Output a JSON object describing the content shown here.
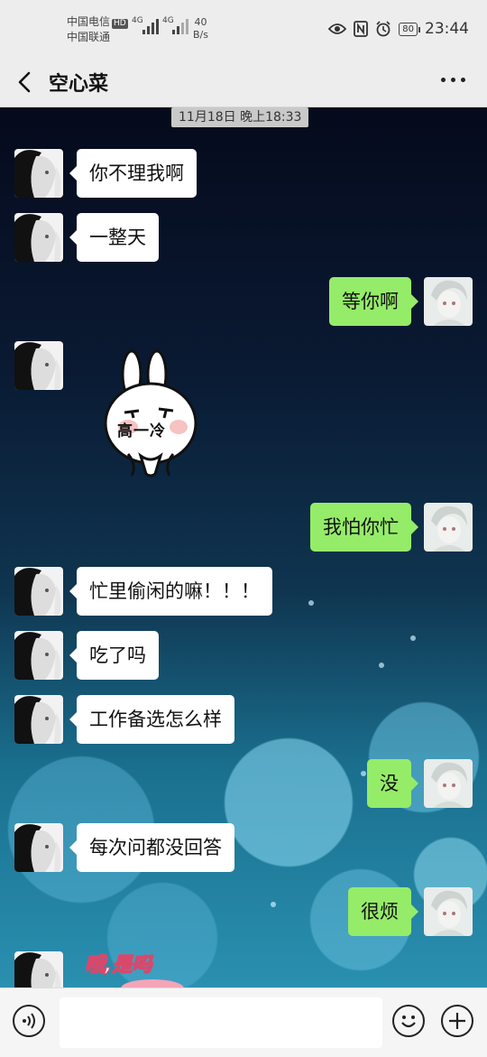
{
  "status_bar": {
    "carrier1": "中国电信",
    "carrier1_badge": "HD",
    "carrier2": "中国联通",
    "network1": "4G",
    "network2": "4G",
    "speed_value": "40",
    "speed_unit": "B/s",
    "battery": "80",
    "time": "23:44"
  },
  "header": {
    "title": "空心菜"
  },
  "chat": {
    "timestamp": "11月18日 晚上18:33",
    "messages": [
      {
        "side": "left",
        "text": "你不理我啊"
      },
      {
        "side": "left",
        "text": "一整天"
      },
      {
        "side": "right",
        "text": "等你啊"
      },
      {
        "side": "left",
        "sticker": "rabbit-cold-face-sticker",
        "text": "高一冷"
      },
      {
        "side": "right",
        "text": "我怕你忙"
      },
      {
        "side": "left",
        "text": "忙里偷闲的嘛！！！"
      },
      {
        "side": "left",
        "text": "吃了吗"
      },
      {
        "side": "left",
        "text": "工作备选怎么样"
      },
      {
        "side": "right",
        "text": "没"
      },
      {
        "side": "left",
        "text": "每次问都没回答"
      },
      {
        "side": "right",
        "text": "很烦"
      },
      {
        "side": "left",
        "sticker": "pink-text-sticker",
        "text": "哦,是吗"
      }
    ]
  },
  "input_bar": {
    "placeholder": ""
  },
  "colors": {
    "bubble_self": "#95ec69",
    "bubble_other": "#ffffff",
    "bar_bg": "#ededed"
  }
}
